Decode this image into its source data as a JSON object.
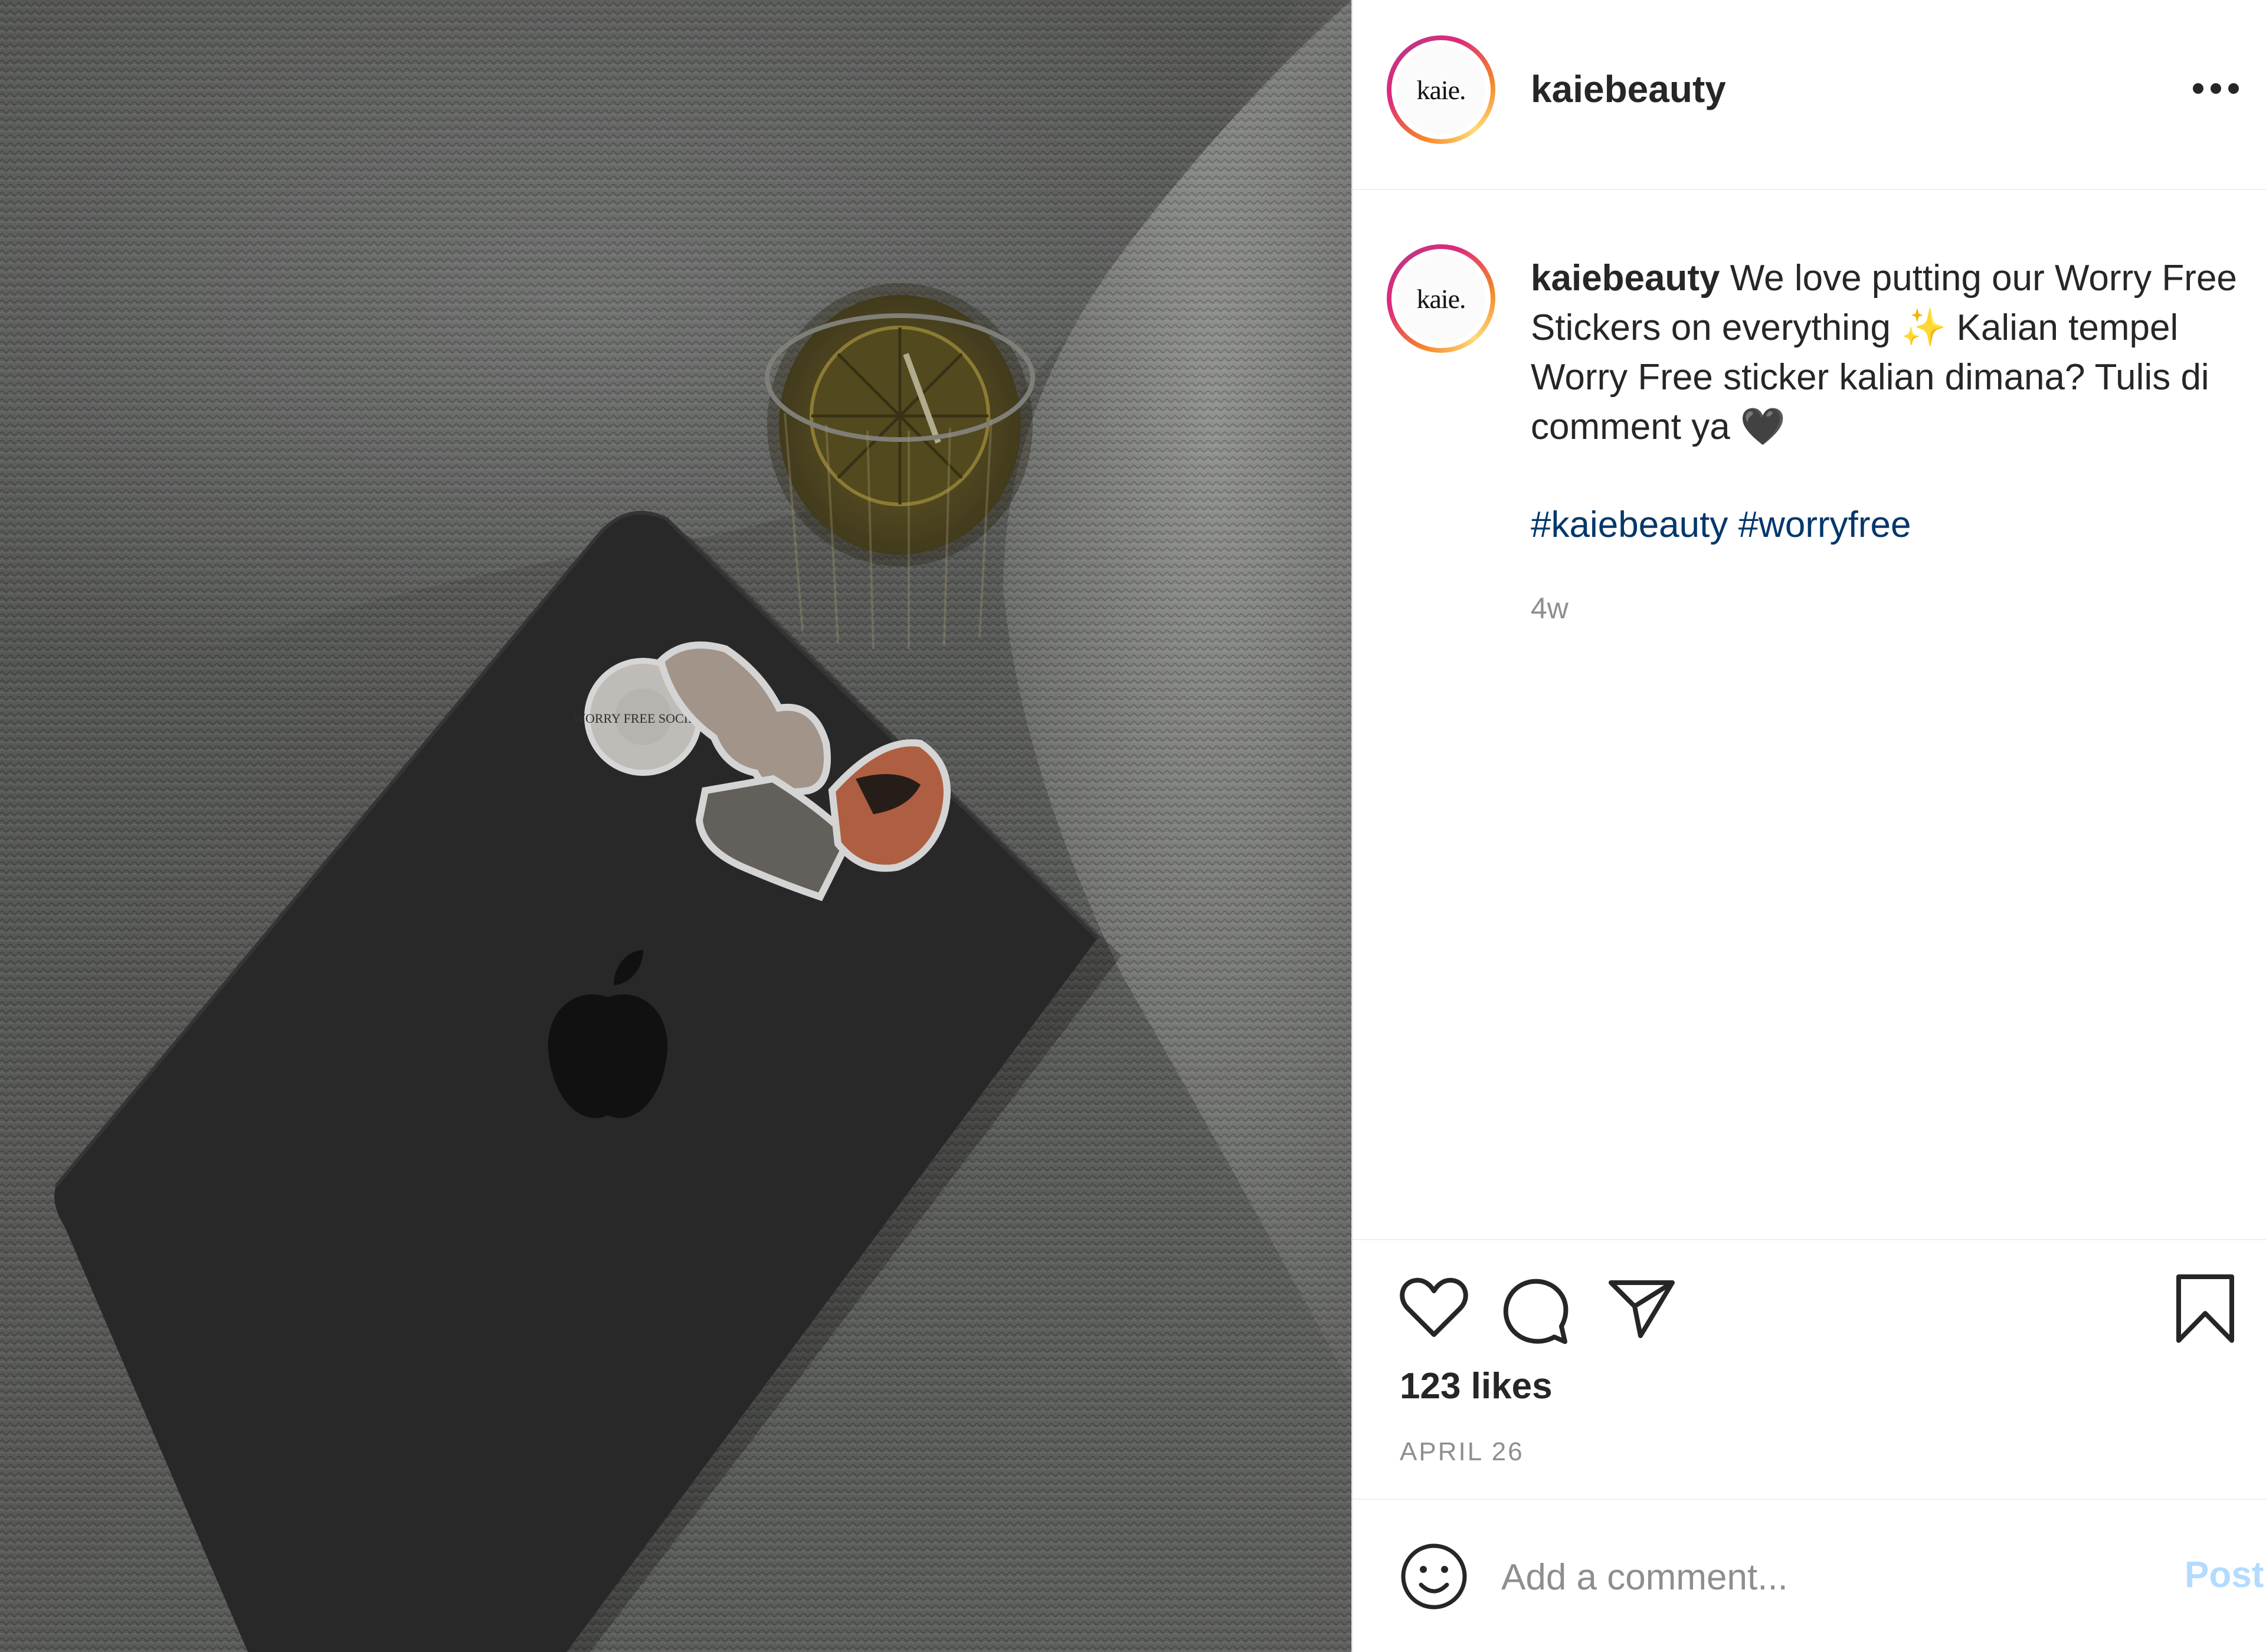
{
  "post": {
    "username": "kaiebeauty",
    "avatar_text": "kaie.",
    "caption": {
      "username": "kaiebeauty",
      "text": " We love putting our Worry Free Stickers on everything ✨ Kalian tempel Worry Free sticker kalian dimana? Tulis di comment ya 🖤"
    },
    "hashtags": [
      "#kaiebeauty",
      "#worryfree"
    ],
    "time_ago": "4w",
    "likes": "123 likes",
    "date": "APRIL 26",
    "comment": {
      "placeholder": "Add a comment...",
      "post_label": "Post"
    },
    "photo": {
      "sticker_text": "WORRY FREE SOCIETY"
    },
    "icons": {
      "more": "more-options-icon",
      "like": "heart-icon",
      "comment": "comment-bubble-icon",
      "share": "paper-plane-icon",
      "save": "bookmark-icon",
      "emoji": "emoji-smile-icon"
    },
    "colors": {
      "link": "#00376b",
      "muted": "#8e8e8e",
      "post_button": "#b3dbff",
      "text": "#262626"
    }
  }
}
